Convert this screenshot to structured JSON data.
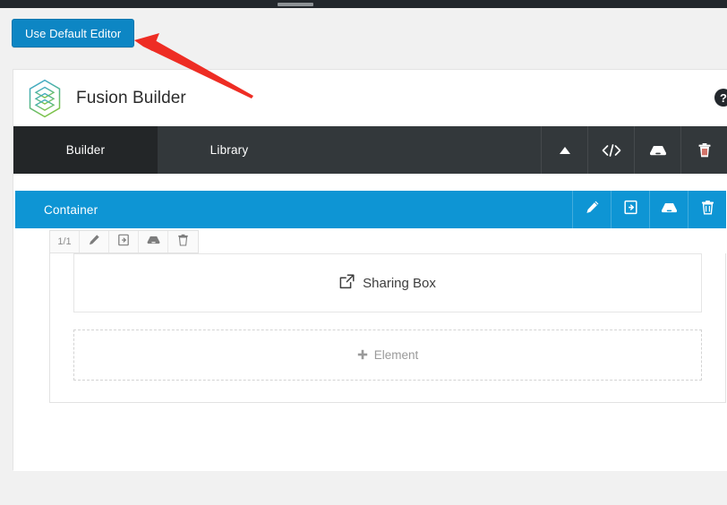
{
  "admin_bar": {
    "name": "wordpress-admin-bar"
  },
  "default_editor_button": {
    "label": "Use Default Editor",
    "color": "#0d86c4"
  },
  "builder": {
    "title": "Fusion Builder",
    "logo_icon": "fusion-hexagon-logo",
    "help_icon": "?",
    "nav": {
      "tabs": [
        {
          "label": "Builder",
          "active": true
        },
        {
          "label": "Library",
          "active": false
        }
      ],
      "actions": [
        {
          "icon": "collapse-up-arrow-icon",
          "name": "collapse-button"
        },
        {
          "icon": "code-brackets-icon",
          "name": "code-button"
        },
        {
          "icon": "save-drawer-icon",
          "name": "save-button"
        },
        {
          "icon": "trash-icon",
          "name": "delete-button"
        }
      ]
    },
    "container": {
      "label": "Container",
      "color": "#0e95d4",
      "actions": [
        {
          "icon": "pencil-icon",
          "name": "edit-container-button"
        },
        {
          "icon": "clone-icon",
          "name": "clone-container-button"
        },
        {
          "icon": "save-drawer-icon",
          "name": "save-container-button"
        },
        {
          "icon": "trash-icon",
          "name": "delete-container-button"
        }
      ]
    },
    "column": {
      "ratio": "1/1",
      "actions": [
        {
          "icon": "pencil-icon",
          "name": "edit-column-button"
        },
        {
          "icon": "clone-icon",
          "name": "clone-column-button"
        },
        {
          "icon": "save-drawer-icon",
          "name": "save-column-button"
        },
        {
          "icon": "trash-icon",
          "name": "delete-column-button"
        }
      ]
    },
    "elements": [
      {
        "label": "Sharing Box",
        "icon": "external-link-icon"
      }
    ],
    "add_element": {
      "label": "Element",
      "icon": "plus-icon"
    }
  },
  "annotation": {
    "arrow_color": "#ee2d24",
    "name": "red-pointer-arrow"
  }
}
